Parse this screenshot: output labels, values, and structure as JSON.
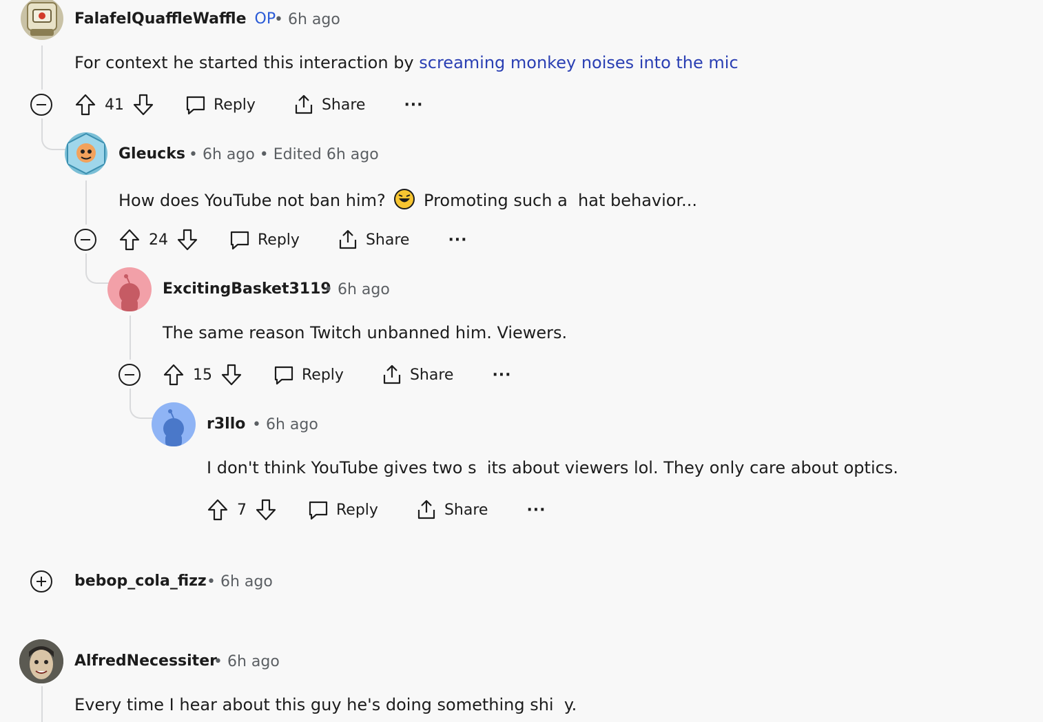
{
  "comments": [
    {
      "username": "FalafelQuaffleWaffle",
      "op_badge": "OP",
      "meta": "• 6h ago",
      "body_pre": "For context he started this interaction by ",
      "body_link": "screaming monkey noises into the mic",
      "score": "41",
      "reply": "Reply",
      "share": "Share",
      "more": "···"
    },
    {
      "username": "Gleucks",
      "meta": "• 6h ago • Edited 6h ago",
      "body_pre": "How does YouTube not ban him?",
      "body_post": "Promoting such a   hat behavior...",
      "score": "24",
      "reply": "Reply",
      "share": "Share",
      "more": "···"
    },
    {
      "username": "ExcitingBasket3119",
      "meta": "• 6h ago",
      "body": "The same reason Twitch unbanned him. Viewers.",
      "score": "15",
      "reply": "Reply",
      "share": "Share",
      "more": "···"
    },
    {
      "username": "r3llo",
      "meta": "• 6h ago",
      "body": "I don't think YouTube gives two s   its about viewers lol. They only care about optics.",
      "score": "7",
      "reply": "Reply",
      "share": "Share",
      "more": "···"
    },
    {
      "username": "bebop_cola_fizz",
      "meta": "• 6h ago"
    },
    {
      "username": "AlfredNecessiter",
      "meta": "• 6h ago",
      "body": "Every time I hear about this guy he's doing something shi   y."
    }
  ],
  "colors": {
    "background": "#f8f8f8",
    "link": "#2a3fb3",
    "op": "#2a5bd7",
    "meta": "#5b5f63",
    "thread_line": "#d9dadc"
  },
  "icons": {
    "upvote": "arrow-up-icon",
    "downvote": "arrow-down-icon",
    "reply": "speech-bubble-icon",
    "share": "share-icon",
    "collapse": "minus-circle-icon",
    "expand": "plus-circle-icon"
  }
}
